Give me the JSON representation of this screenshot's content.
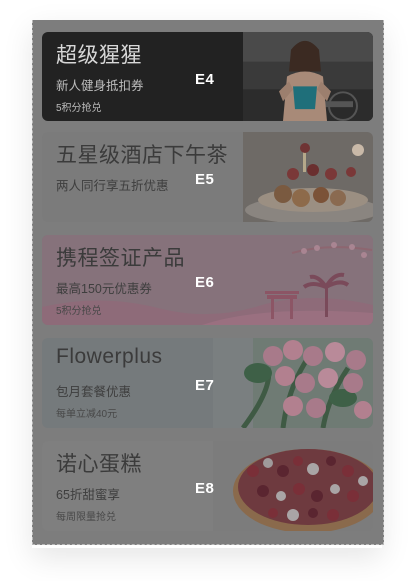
{
  "cards": [
    {
      "title": "超级猩猩",
      "subtitle": "新人健身抵扣券",
      "note": "5积分抢兑",
      "tag": "E4"
    },
    {
      "title": "五星级酒店下午茶",
      "subtitle": "两人同行享五折优惠",
      "note": "",
      "tag": "E5"
    },
    {
      "title": "携程签证产品",
      "subtitle": "最高150元优惠券",
      "note": "5积分抢兑",
      "tag": "E6"
    },
    {
      "title": "Flowerplus",
      "subtitle": "包月套餐优惠",
      "note": "每单立减40元",
      "tag": "E7"
    },
    {
      "title": "诺心蛋糕",
      "subtitle": "65折甜蜜享",
      "note": "每周限量抢兑",
      "tag": "E8"
    }
  ],
  "icons": [
    "fitness-photo",
    "afternoon-tea-photo",
    "travel-illustration",
    "flowers-photo",
    "cake-photo"
  ]
}
